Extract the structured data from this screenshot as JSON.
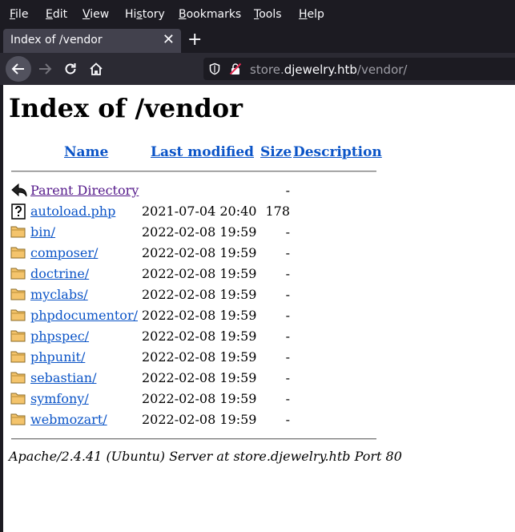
{
  "menubar": {
    "items": [
      {
        "label": "File",
        "key": "F",
        "rest": "ile"
      },
      {
        "label": "Edit",
        "key": "E",
        "rest": "dit"
      },
      {
        "label": "View",
        "key": "V",
        "rest": "iew"
      },
      {
        "label": "History",
        "pre": "Hi",
        "key": "s",
        "rest": "tory"
      },
      {
        "label": "Bookmarks",
        "key": "B",
        "rest": "ookmarks"
      },
      {
        "label": "Tools",
        "key": "T",
        "rest": "ools"
      },
      {
        "label": "Help",
        "key": "H",
        "rest": "elp"
      }
    ]
  },
  "tab": {
    "title": "Index of /vendor",
    "close": "✕"
  },
  "newtab": {
    "label": "+"
  },
  "urlbar": {
    "host_prefix": "store.",
    "host_main": "djewelry.htb",
    "path": "/vendor/"
  },
  "colors": {
    "chrome_bg": "#1c1b22",
    "toolbar_bg": "#2b2a33",
    "tab_bg": "#42414d",
    "link": "#0b54c7",
    "visited": "#551a8b"
  },
  "page": {
    "heading": "Index of /vendor",
    "columns": {
      "name": "Name",
      "modified": "Last modified",
      "size": "Size",
      "description": "Description"
    },
    "rows": [
      {
        "name": "Parent Directory",
        "date": "",
        "size": "-",
        "icon": "back-icon",
        "visited": true
      },
      {
        "name": "autoload.php",
        "date": "2021-07-04 20:40",
        "size": "178",
        "icon": "unknown-file-icon"
      },
      {
        "name": "bin/",
        "date": "2022-02-08 19:59",
        "size": "-",
        "icon": "folder-icon"
      },
      {
        "name": "composer/",
        "date": "2022-02-08 19:59",
        "size": "-",
        "icon": "folder-icon"
      },
      {
        "name": "doctrine/",
        "date": "2022-02-08 19:59",
        "size": "-",
        "icon": "folder-icon"
      },
      {
        "name": "myclabs/",
        "date": "2022-02-08 19:59",
        "size": "-",
        "icon": "folder-icon"
      },
      {
        "name": "phpdocumentor/",
        "date": "2022-02-08 19:59",
        "size": "-",
        "icon": "folder-icon"
      },
      {
        "name": "phpspec/",
        "date": "2022-02-08 19:59",
        "size": "-",
        "icon": "folder-icon"
      },
      {
        "name": "phpunit/",
        "date": "2022-02-08 19:59",
        "size": "-",
        "icon": "folder-icon"
      },
      {
        "name": "sebastian/",
        "date": "2022-02-08 19:59",
        "size": "-",
        "icon": "folder-icon"
      },
      {
        "name": "symfony/",
        "date": "2022-02-08 19:59",
        "size": "-",
        "icon": "folder-icon"
      },
      {
        "name": "webmozart/",
        "date": "2022-02-08 19:59",
        "size": "-",
        "icon": "folder-icon"
      }
    ],
    "footer": "Apache/2.4.41 (Ubuntu) Server at store.djewelry.htb Port 80"
  }
}
